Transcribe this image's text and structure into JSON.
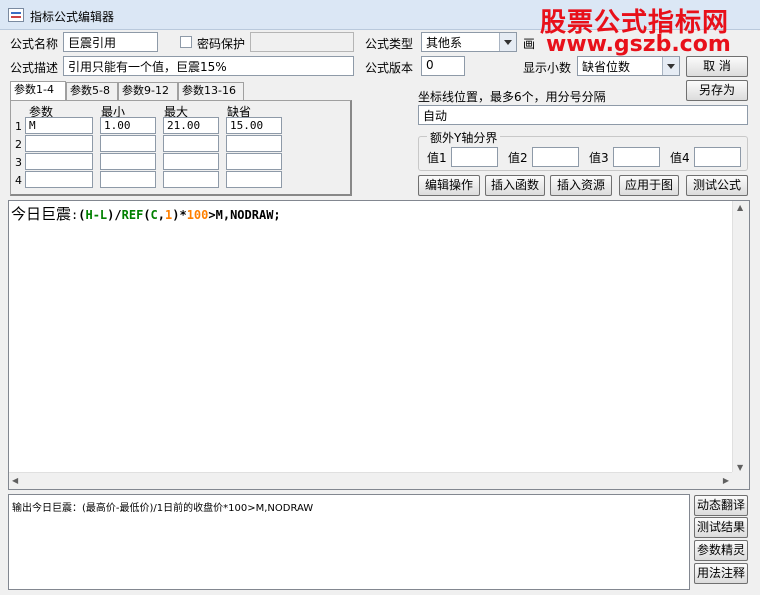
{
  "window": {
    "title": "指标公式编辑器"
  },
  "watermark": {
    "line1": "股票公式指标网",
    "line2": "www.gszb.com",
    "color": "#e8101a"
  },
  "form": {
    "name_label": "公式名称",
    "name_value": "巨震引用",
    "password_label": "密码保护",
    "password_checked": false,
    "type_label": "公式类型",
    "type_value": "其他系",
    "draw_label": "画",
    "desc_label": "公式描述",
    "desc_value": "引用只能有一个值，巨震15%",
    "version_label": "公式版本",
    "version_value": "0",
    "decimal_label": "显示小数",
    "decimal_value": "缺省位数",
    "cancel_label": "取  消",
    "saveas_label": "另存为"
  },
  "params": {
    "tabs": [
      "参数1-4",
      "参数5-8",
      "参数9-12",
      "参数13-16"
    ],
    "headers": [
      "参数",
      "最小",
      "最大",
      "缺省"
    ],
    "row_numbers": [
      "1",
      "2",
      "3",
      "4"
    ],
    "rows": [
      [
        "M",
        "1.00",
        "21.00",
        "15.00"
      ],
      [
        "",
        "",
        "",
        ""
      ],
      [
        "",
        "",
        "",
        ""
      ],
      [
        "",
        "",
        "",
        ""
      ]
    ]
  },
  "axis": {
    "label": "坐标线位置，最多6个，用分号分隔",
    "value": "自动",
    "group_title": "额外Y轴分界",
    "value_labels": [
      "值1",
      "值2",
      "值3",
      "值4"
    ]
  },
  "toolbar": [
    "编辑操作",
    "插入函数",
    "插入资源",
    "应用于图",
    "测试公式"
  ],
  "code": {
    "name": "今日巨震",
    "colon": ":",
    "tokens": [
      {
        "t": "(",
        "c": "#000000"
      },
      {
        "t": "H-L",
        "c": "#008000"
      },
      {
        "t": ")/",
        "c": "#000000"
      },
      {
        "t": "REF",
        "c": "#008000"
      },
      {
        "t": "(",
        "c": "#000000"
      },
      {
        "t": "C",
        "c": "#008000"
      },
      {
        "t": ",",
        "c": "#000000"
      },
      {
        "t": "1",
        "c": "#ff8000"
      },
      {
        "t": ")*",
        "c": "#000000"
      },
      {
        "t": "100",
        "c": "#ff8000"
      },
      {
        "t": ">M,NODRAW;",
        "c": "#000000"
      }
    ]
  },
  "output": {
    "text": "输出今日巨震：(最高价-最低价)/1日前的收盘价*100>M,NODRAW"
  },
  "side_buttons": [
    "动态翻译",
    "测试结果",
    "参数精灵",
    "用法注释"
  ]
}
